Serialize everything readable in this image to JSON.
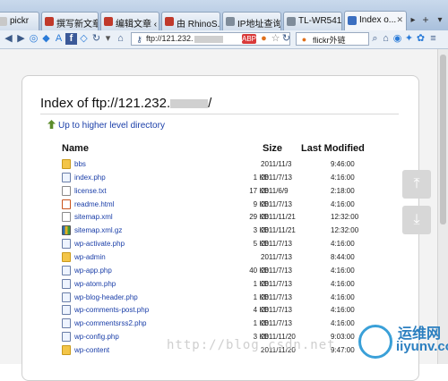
{
  "browser": {
    "tabs": [
      {
        "label": "pickr",
        "favicon_color": "#c8c8c8"
      },
      {
        "label": "撰写新文章 ...",
        "favicon_color": "#c0392b"
      },
      {
        "label": "编辑文章 ‹ ...",
        "favicon_color": "#c0392b"
      },
      {
        "label": "由 RhinoS...",
        "favicon_color": "#c0392b"
      },
      {
        "label": "IP地址查询...",
        "favicon_color": "#7f8c9a"
      },
      {
        "label": "TL-WR541...",
        "favicon_color": "#7f8c9a"
      },
      {
        "label": "Index o...",
        "favicon_color": "#3c6fc0"
      }
    ],
    "address": {
      "prefix": "ftp://121.232."
    },
    "search": {
      "value": "flickr外链"
    }
  },
  "listing": {
    "title_prefix": "Index of ftp://121.232.",
    "title_suffix": "/",
    "up_link": "Up to higher level directory",
    "headers": {
      "name": "Name",
      "size": "Size",
      "modified": "Last Modified"
    },
    "rows": [
      {
        "name": "bbs",
        "icon": "folder",
        "size": "",
        "date": "2011/11/3",
        "time": "9:46:00"
      },
      {
        "name": "index.php",
        "icon": "php",
        "size": "1 KB",
        "date": "2011/7/13",
        "time": "4:16:00"
      },
      {
        "name": "license.txt",
        "icon": "text",
        "size": "17 KB",
        "date": "2011/6/9",
        "time": "2:18:00"
      },
      {
        "name": "readme.html",
        "icon": "html",
        "size": "9 KB",
        "date": "2011/7/13",
        "time": "4:16:00"
      },
      {
        "name": "sitemap.xml",
        "icon": "text",
        "size": "29 KB",
        "date": "2011/11/21",
        "time": "12:32:00"
      },
      {
        "name": "sitemap.xml.gz",
        "icon": "archive",
        "size": "3 KB",
        "date": "2011/11/21",
        "time": "12:32:00"
      },
      {
        "name": "wp-activate.php",
        "icon": "php",
        "size": "5 KB",
        "date": "2011/7/13",
        "time": "4:16:00"
      },
      {
        "name": "wp-admin",
        "icon": "folder",
        "size": "",
        "date": "2011/7/13",
        "time": "8:44:00"
      },
      {
        "name": "wp-app.php",
        "icon": "php",
        "size": "40 KB",
        "date": "2011/7/13",
        "time": "4:16:00"
      },
      {
        "name": "wp-atom.php",
        "icon": "php",
        "size": "1 KB",
        "date": "2011/7/13",
        "time": "4:16:00"
      },
      {
        "name": "wp-blog-header.php",
        "icon": "php",
        "size": "1 KB",
        "date": "2011/7/13",
        "time": "4:16:00"
      },
      {
        "name": "wp-comments-post.php",
        "icon": "php",
        "size": "4 KB",
        "date": "2011/7/13",
        "time": "4:16:00"
      },
      {
        "name": "wp-commentsrss2.php",
        "icon": "php",
        "size": "1 KB",
        "date": "2011/7/13",
        "time": "4:16:00"
      },
      {
        "name": "wp-config.php",
        "icon": "php",
        "size": "3 KB",
        "date": "2011/11/20",
        "time": "9:03:00"
      },
      {
        "name": "wp-content",
        "icon": "folder",
        "size": "",
        "date": "2011/11/20",
        "time": "9:47:00"
      }
    ]
  },
  "watermark": "http://blog.csdn.net",
  "logo": {
    "line1": "运维网",
    "line2": "iiyunv.com"
  }
}
